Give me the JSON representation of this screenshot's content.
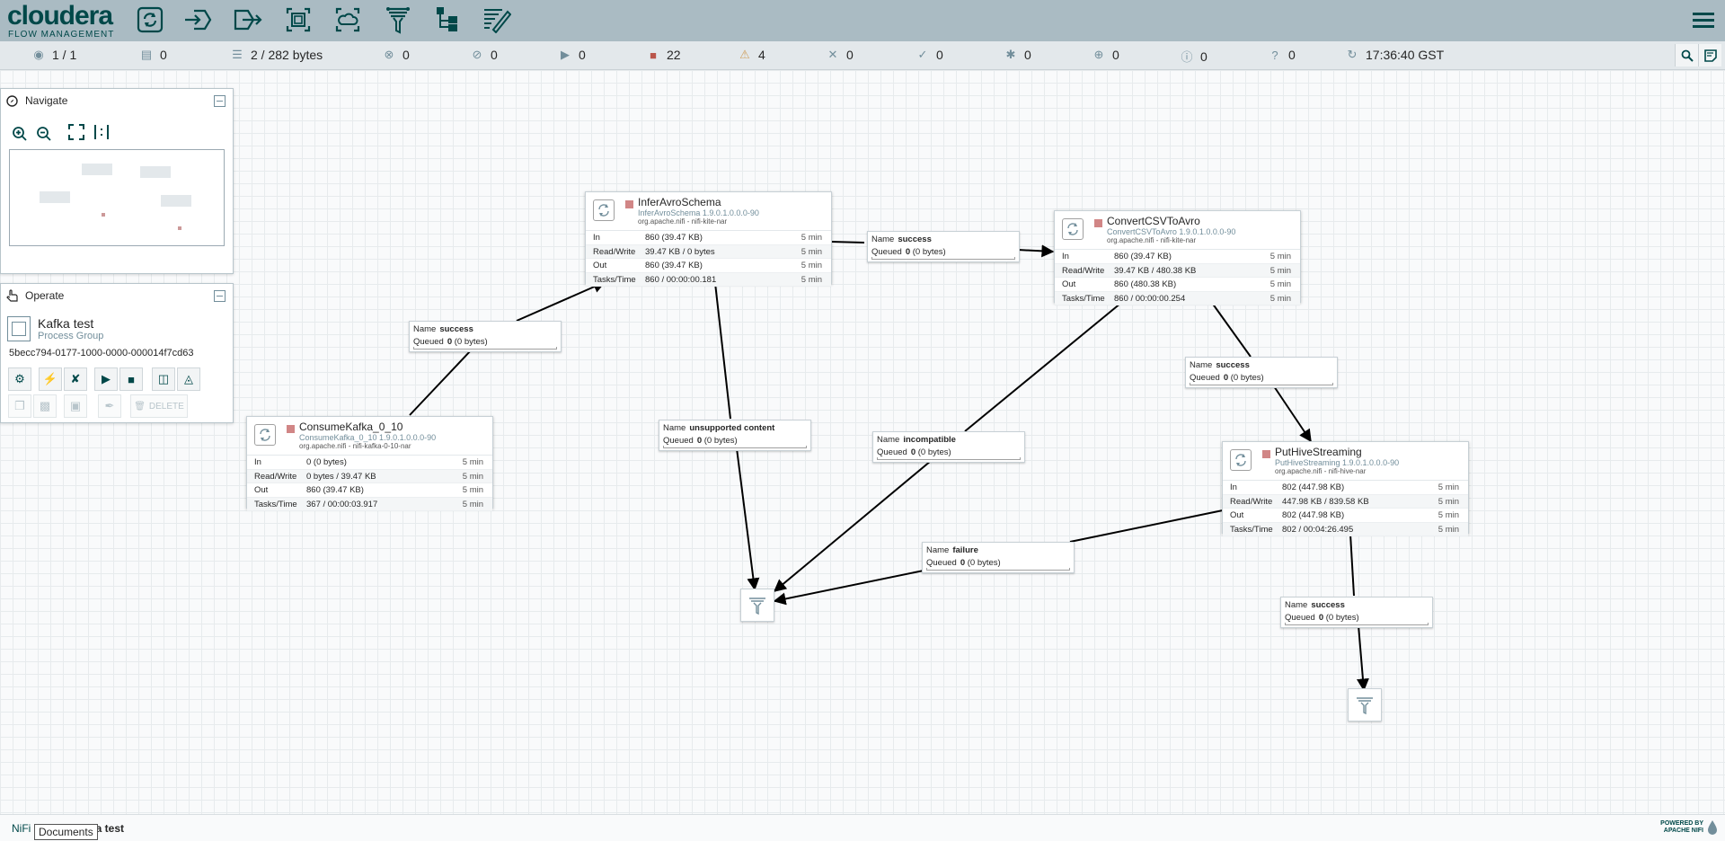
{
  "brand": {
    "name": "cloudera",
    "subtitle": "FLOW MANAGEMENT"
  },
  "toolbar": {
    "items": [
      {
        "name": "processor",
        "icon": "processor-icon"
      },
      {
        "name": "input-port",
        "icon": "input-port-icon"
      },
      {
        "name": "output-port",
        "icon": "output-port-icon"
      },
      {
        "name": "process-group",
        "icon": "process-group-icon"
      },
      {
        "name": "remote-process-group",
        "icon": "remote-process-group-icon"
      },
      {
        "name": "funnel",
        "icon": "funnel-icon"
      },
      {
        "name": "template",
        "icon": "template-icon"
      },
      {
        "name": "label",
        "icon": "label-icon"
      }
    ]
  },
  "status": {
    "cluster": "1 / 1",
    "transmitting": "0",
    "queued": "2 / 282 bytes",
    "transmitting_rpg": "0",
    "not_transmitting_rpg": "0",
    "running": "0",
    "stopped": "22",
    "invalid": "4",
    "disabled": "0",
    "up_to_date": "0",
    "locally_modified": "0",
    "stale": "0",
    "locally_modified_stale": "0",
    "sync_failure": "0",
    "last_refresh": "17:36:40 GST"
  },
  "navigate": {
    "title": "Navigate"
  },
  "operate": {
    "title": "Operate",
    "name": "Kafka test",
    "type": "Process Group",
    "id": "5becc794-0177-1000-0000-000014f7cd63",
    "delete_label": "DELETE"
  },
  "processors": {
    "consume": {
      "name": "ConsumeKafka_0_10",
      "type": "ConsumeKafka_0_10 1.9.0.1.0.0.0-90",
      "bundle": "org.apache.nifi - nifi-kafka-0-10-nar",
      "in": "0 (0 bytes)",
      "rw": "0 bytes / 39.47 KB",
      "out": "860 (39.47 KB)",
      "tasks": "367 / 00:00:03.917"
    },
    "infer": {
      "name": "InferAvroSchema",
      "type": "InferAvroSchema 1.9.0.1.0.0.0-90",
      "bundle": "org.apache.nifi - nifi-kite-nar",
      "in": "860 (39.47 KB)",
      "rw": "39.47 KB / 0 bytes",
      "out": "860 (39.47 KB)",
      "tasks": "860 / 00:00:00.181"
    },
    "convert": {
      "name": "ConvertCSVToAvro",
      "type": "ConvertCSVToAvro 1.9.0.1.0.0.0-90",
      "bundle": "org.apache.nifi - nifi-kite-nar",
      "in": "860 (39.47 KB)",
      "rw": "39.47 KB / 480.38 KB",
      "out": "860 (480.38 KB)",
      "tasks": "860 / 00:00:00.254"
    },
    "put": {
      "name": "PutHiveStreaming",
      "type": "PutHiveStreaming 1.9.0.1.0.0.0-90",
      "bundle": "org.apache.nifi - nifi-hive-nar",
      "in": "802 (447.98 KB)",
      "rw": "447.98 KB / 839.58 KB",
      "out": "802 (447.98 KB)",
      "tasks": "802 / 00:04:26.495"
    }
  },
  "labels": {
    "in": "In",
    "rw": "Read/Write",
    "out": "Out",
    "tasks": "Tasks/Time",
    "window": "5 min",
    "name": "Name",
    "queued": "Queued"
  },
  "connections": {
    "c1": {
      "name": "success",
      "queued": "0",
      "bytes": "(0 bytes)"
    },
    "c2": {
      "name": "success",
      "queued": "0",
      "bytes": "(0 bytes)"
    },
    "c3": {
      "name": "unsupported content",
      "queued": "0",
      "bytes": "(0 bytes)"
    },
    "c4": {
      "name": "incompatible",
      "queued": "0",
      "bytes": "(0 bytes)"
    },
    "c5": {
      "name": "success",
      "queued": "0",
      "bytes": "(0 bytes)"
    },
    "c6": {
      "name": "failure",
      "queued": "0",
      "bytes": "(0 bytes)"
    },
    "c7": {
      "name": "success",
      "queued": "0",
      "bytes": "(0 bytes)"
    }
  },
  "footer": {
    "root": "NiFi",
    "tooltip": "Documents",
    "current": "ka test",
    "powered1": "POWERED BY",
    "powered2": "APACHE NIFI"
  },
  "colors": {
    "brand": "#004849",
    "header": "#aabbc3",
    "stopped": "#d18686",
    "invalid": "#ba554a"
  }
}
